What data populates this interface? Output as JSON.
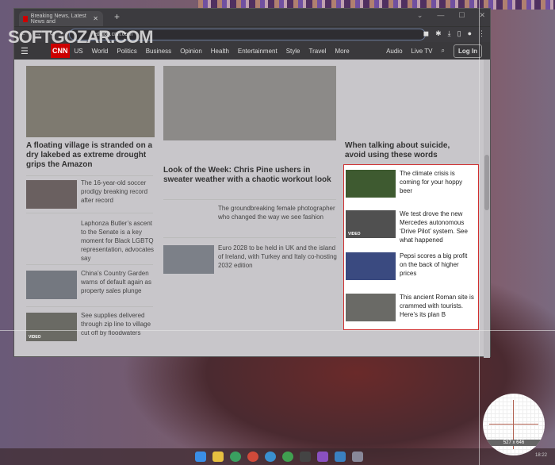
{
  "browser": {
    "tab_title": "Breaking News, Latest News and",
    "url": "edition.cnn.com",
    "new_tab": "+"
  },
  "watermark": "SOFTGOZAR.COM",
  "nav": {
    "logo": "CNN",
    "items": [
      "US",
      "World",
      "Politics",
      "Business",
      "Opinion",
      "Health",
      "Entertainment",
      "Style",
      "Travel",
      "More"
    ],
    "right": [
      "Audio",
      "Live TV"
    ],
    "login": "Log In"
  },
  "left": {
    "headline": "A floating village is stranded on a dry lakebed as extreme drought grips the Amazon",
    "stories": [
      "The 16-year-old soccer prodigy breaking record after record",
      "Laphonza Butler’s ascent to the Senate is a key moment for Black LGBTQ representation, advocates say",
      "China’s Country Garden warns of default again as property sales plunge",
      "See supplies delivered through zip line to village cut off by floodwaters"
    ],
    "video_label": "VIDEO"
  },
  "middle": {
    "headline": "Look of the Week: Chris Pine ushers in sweater weather with a chaotic workout look",
    "stories": [
      "The groundbreaking female photographer who changed the way we see fashion",
      "Euro 2028 to be held in UK and the island of Ireland, with Turkey and Italy co-hosting 2032 edition"
    ]
  },
  "right": {
    "headline": "When talking about suicide, avoid using these words",
    "stories": [
      "The climate crisis is coming for your hoppy beer",
      "We test drove the new Mercedes autonomous ‘Drive Pilot’ system. See what happened",
      "Pepsi scores a big profit on the back of higher prices",
      "This ancient Roman site is crammed with tourists. Here’s its plan B"
    ],
    "video_label": "VIDEO"
  },
  "magnifier": {
    "size_label": "527 x 646"
  },
  "taskbar": {
    "clock": "18:22"
  },
  "colors": {
    "selection_border": "#d03030",
    "cnn_red": "#cc0000"
  }
}
